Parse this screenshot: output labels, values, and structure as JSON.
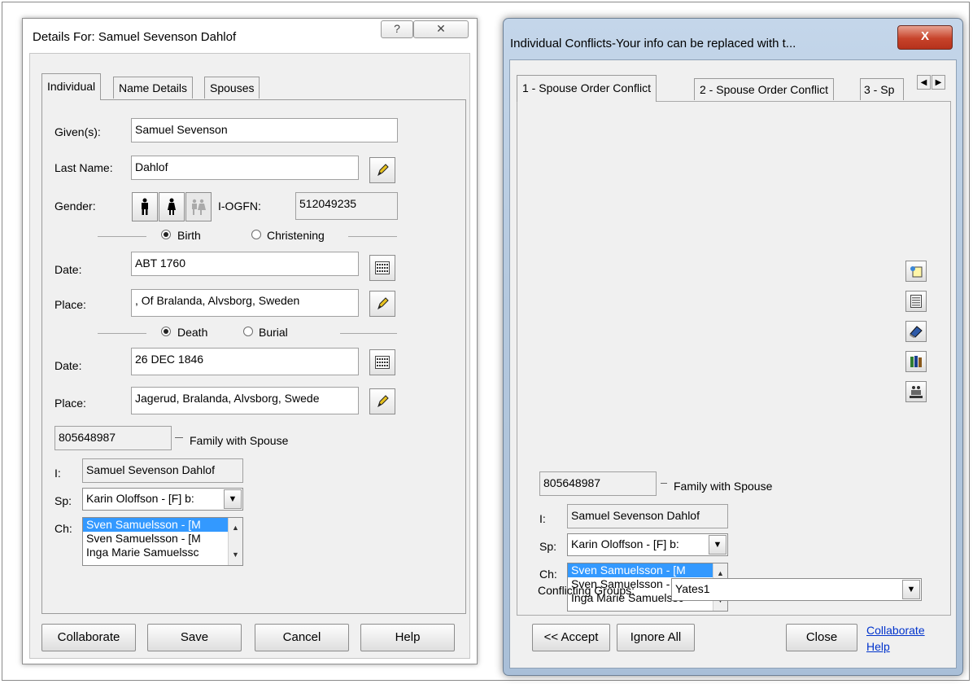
{
  "left_dialog": {
    "title": "Details For:  Samuel Sevenson Dahlof",
    "help_glyph": "?",
    "close_glyph": "✕",
    "tabs": [
      {
        "label": "Individual"
      },
      {
        "label": "Name Details"
      },
      {
        "label": "Spouses"
      }
    ],
    "given_label": "Given(s):",
    "given_value": "Samuel Sevenson",
    "lastname_label": "Last Name:",
    "lastname_value": "Dahlof",
    "gender_label": "Gender:",
    "ogfn_label": "I-OGFN:",
    "ogfn_value": "512049235",
    "birth_label": "Birth",
    "christening_label": "Christening",
    "birth_date_label": "Date:",
    "birth_date_value": "ABT 1760",
    "birth_place_label": "Place:",
    "birth_place_value": ", Of Bralanda, Alvsborg, Sweden",
    "death_label": "Death",
    "burial_label": "Burial",
    "death_date_label": "Date:",
    "death_date_value": "26 DEC 1846",
    "death_place_label": "Place:",
    "death_place_value": "Jagerud, Bralanda, Alvsborg, Swede",
    "family_id": "805648987",
    "family_label": "Family with Spouse",
    "i_label": "I:",
    "i_value": "Samuel Sevenson Dahlof",
    "sp_label": "Sp:",
    "sp_value": "Karin Oloffson - [F] b:",
    "ch_label": "Ch:",
    "children": [
      "Sven Samuelsson - [M",
      "Sven Samuelsson - [M",
      "Inga Marie Samuelssc"
    ],
    "buttons": {
      "collaborate": "Collaborate",
      "save": "Save",
      "cancel": "Cancel",
      "help": "Help"
    }
  },
  "right_dialog": {
    "title": "Individual Conflicts-Your info can be replaced with t...",
    "close_glyph": "X",
    "tabs": [
      {
        "label": "1 - Spouse Order Conflict"
      },
      {
        "label": "2 - Spouse Order Conflict"
      },
      {
        "label": "3 - Sp"
      }
    ],
    "family_id": "805648987",
    "family_label": "Family with Spouse",
    "i_label": "I:",
    "i_value": "Samuel Sevenson Dahlof",
    "sp_label": "Sp:",
    "sp_value": "Karin Oloffson - [F] b:",
    "ch_label": "Ch:",
    "children": [
      "Sven Samuelsson - [M",
      "Sven Samuelsson - [M",
      "Inga Marie Samuelssc"
    ],
    "conflicting_label": "Conflicting Groups:",
    "conflicting_value": "Yates1",
    "buttons": {
      "accept": "<< Accept",
      "ignore_all": "Ignore All",
      "close": "Close"
    },
    "links": {
      "collaborate": "Collaborate",
      "help": "Help"
    }
  },
  "icons": {
    "calendar": "calendar-icon",
    "pencil": "pencil-icon",
    "male": "male-icon",
    "female": "female-icon",
    "unknown": "unknown-gender-icon"
  },
  "colors": {
    "selection": "#3399ff",
    "window_frame": "#b5c9df",
    "close_red": "#c7432a",
    "link": "#0033cc"
  }
}
